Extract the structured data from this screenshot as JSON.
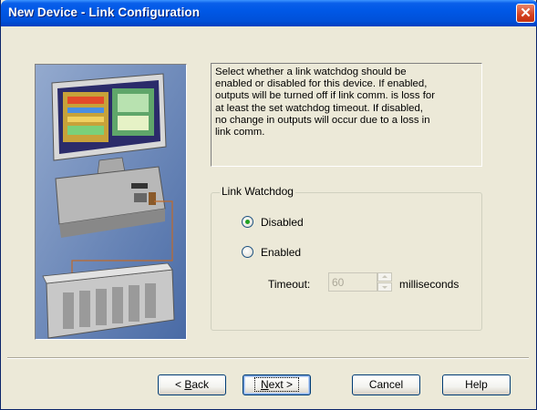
{
  "window": {
    "title": "New Device - Link Configuration",
    "close_icon": "close-x-icon"
  },
  "illustration": {
    "description_icon": "computer-and-plc-illustration"
  },
  "description": {
    "lines": [
      "Select whether a link watchdog should be",
      "enabled or disabled for this device.  If enabled,",
      "outputs will be turned off if link comm. is loss for",
      "at least the set watchdog timeout.  If disabled,",
      "no change in outputs will occur due to a loss in",
      "link comm."
    ]
  },
  "watchdog": {
    "group_label": "Link Watchdog",
    "disabled_label": "Disabled",
    "enabled_label": "Enabled",
    "selected": "Disabled",
    "timeout_label": "Timeout:",
    "timeout_value": "60",
    "unit_label": "milliseconds"
  },
  "buttons": {
    "back_prefix": "< ",
    "back_mnemonic": "B",
    "back_rest": "ack",
    "next_mnemonic": "N",
    "next_rest": "ext >",
    "cancel": "Cancel",
    "help": "Help"
  },
  "colors": {
    "titlebar": "#0058e6",
    "dialog_bg": "#ece9d8",
    "illustration_bg": "#5a7cb4",
    "radio_dot": "#21a121"
  }
}
